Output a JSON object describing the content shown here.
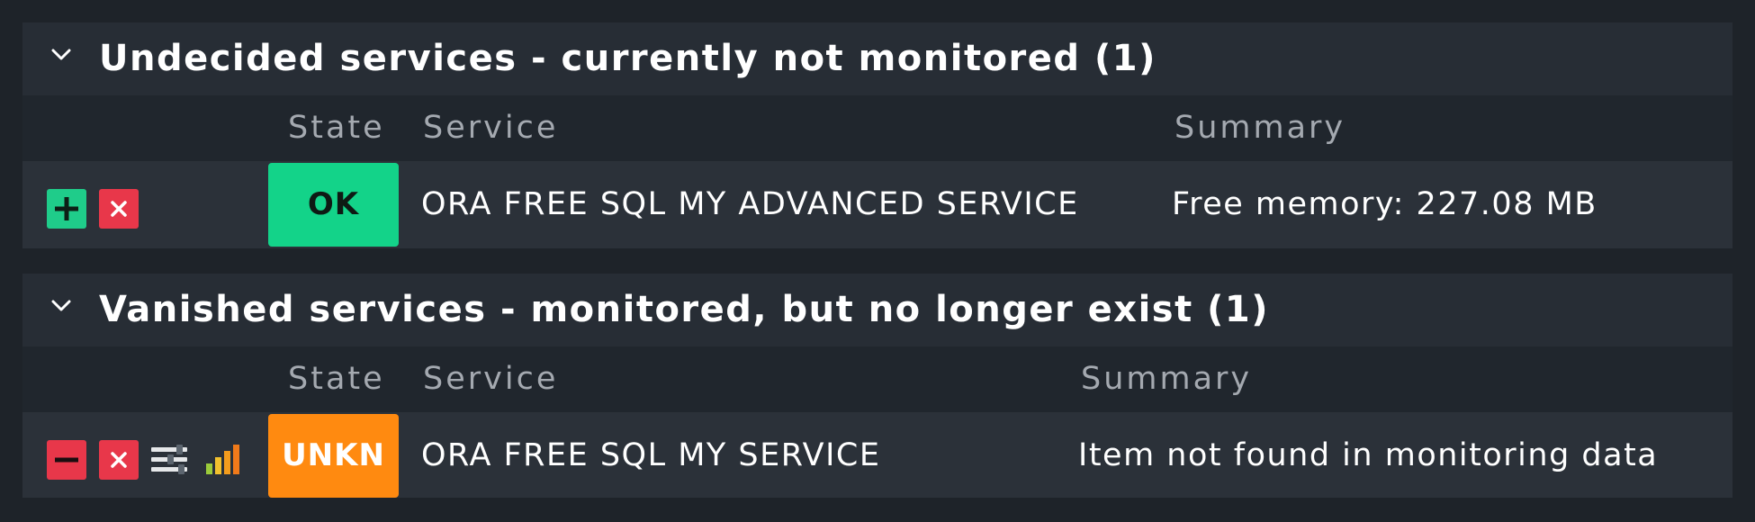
{
  "sections": [
    {
      "title": "Undecided services - currently not monitored (1)",
      "columns": {
        "state": "State",
        "service": "Service",
        "summary": "Summary"
      },
      "rows": [
        {
          "state": "OK",
          "service": "ORA FREE SQL MY ADVANCED SERVICE",
          "summary": "Free memory: 227.08 MB",
          "actions": [
            "add-icon",
            "remove-icon"
          ]
        }
      ]
    },
    {
      "title": "Vanished services - monitored, but no longer exist (1)",
      "columns": {
        "state": "State",
        "service": "Service",
        "summary": "Summary"
      },
      "rows": [
        {
          "state": "UNKN",
          "service": "ORA FREE SQL MY SERVICE",
          "summary": "Item not found in monitoring data",
          "actions": [
            "minus-icon",
            "remove-icon",
            "parameters-icon",
            "graph-icon"
          ]
        }
      ]
    }
  ],
  "colors": {
    "ok": "#13d389",
    "unknown": "#ff8a10",
    "action_green": "#1fcc8a",
    "action_red": "#e8374a"
  }
}
